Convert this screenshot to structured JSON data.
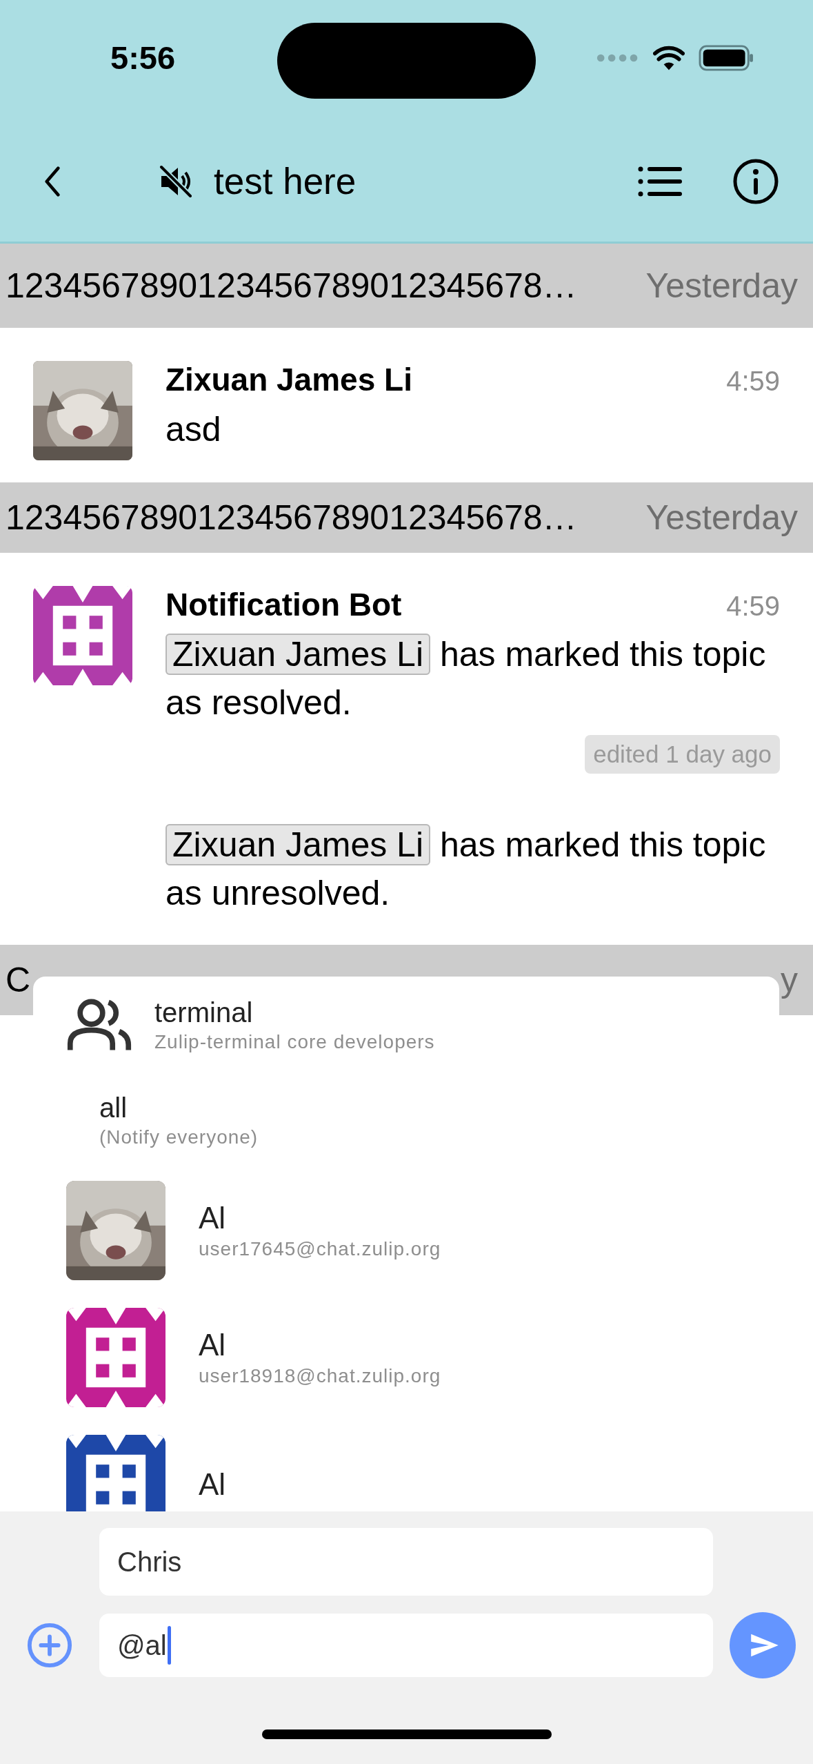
{
  "status_bar": {
    "time": "5:56"
  },
  "header": {
    "title": "test here",
    "muted": true
  },
  "chat": [
    {
      "kind": "topic_header",
      "topic": "1234567890123456789012345678…",
      "date": "Yesterday"
    },
    {
      "kind": "message",
      "sender": "Zixuan James Li",
      "time": "4:59",
      "text": "asd"
    },
    {
      "kind": "topic_header",
      "topic": "1234567890123456789012345678…",
      "date": "Yesterday"
    },
    {
      "kind": "message",
      "sender": "Notification Bot",
      "time": "4:59",
      "avatar": {
        "kind": "identicon",
        "color": "#b03caa"
      },
      "mention": "Zixuan James Li",
      "text": "has marked this topic as resolved.",
      "edited": "edited 1 day ago"
    },
    {
      "kind": "message",
      "mention": "Zixuan James Li",
      "text": "has marked this topic as unresolved."
    },
    {
      "kind": "topic_header",
      "topic": "C",
      "date": "y"
    }
  ],
  "autocomplete": [
    {
      "kind": "group",
      "name": "terminal",
      "detail": "Zulip-terminal core developers"
    },
    {
      "kind": "wildcard",
      "name": "all",
      "detail": "(Notify everyone)"
    },
    {
      "kind": "user",
      "name": "Al",
      "detail": "user17645@chat.zulip.org"
    },
    {
      "kind": "user",
      "name": "Al",
      "detail": "user18918@chat.zulip.org",
      "avatar": {
        "kind": "identicon",
        "color": "#c21f93"
      }
    },
    {
      "kind": "user",
      "name": "Al",
      "avatar": {
        "kind": "identicon",
        "color": "#1e48a8"
      }
    }
  ],
  "compose": {
    "topic": "Chris",
    "content": "@al"
  }
}
